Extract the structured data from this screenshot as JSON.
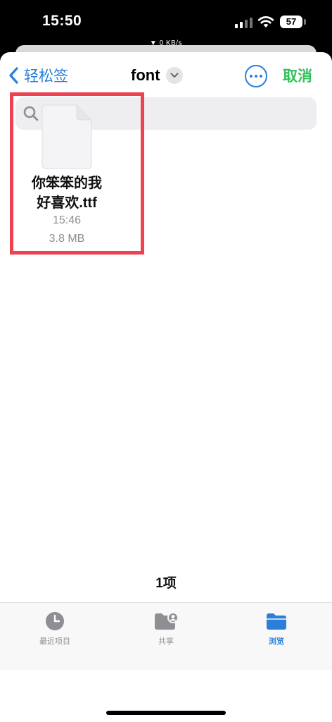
{
  "status_bar": {
    "time": "15:50",
    "battery": "57",
    "network_speed": "▼ 0 KB/s"
  },
  "nav": {
    "back_label": "轻松签",
    "title": "font",
    "cancel_label": "取消"
  },
  "search": {
    "placeholder": "搜索"
  },
  "files": [
    {
      "name_line1": "你笨笨的我",
      "name_line2": "好喜欢.ttf",
      "time": "15:46",
      "size": "3.8 MB"
    }
  ],
  "item_count": "1项",
  "tabs": [
    {
      "label": "最近项目",
      "icon": "clock-icon",
      "active": false
    },
    {
      "label": "共享",
      "icon": "shared-folder-icon",
      "active": false
    },
    {
      "label": "浏览",
      "icon": "folder-icon",
      "active": true
    }
  ],
  "colors": {
    "accent": "#2b7fd8",
    "cancel": "#31c05a",
    "highlight": "#ef4250"
  }
}
